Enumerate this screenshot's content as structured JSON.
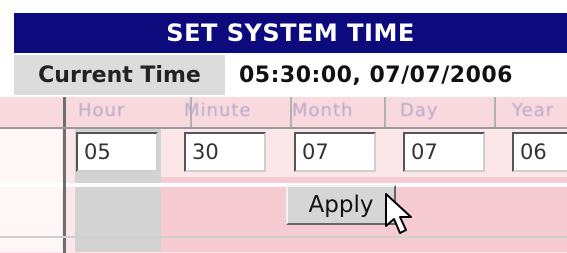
{
  "title": "SET SYSTEM TIME",
  "current_time": {
    "label": "Current Time",
    "value": "05:30:00, 07/07/2006"
  },
  "columns": [
    {
      "name": "hour",
      "header": "Hour",
      "value": "05"
    },
    {
      "name": "minute",
      "header": "Minute",
      "value": "30"
    },
    {
      "name": "month",
      "header": "Month",
      "value": "07"
    },
    {
      "name": "day",
      "header": "Day",
      "value": "07"
    },
    {
      "name": "year",
      "header": "Year",
      "value": "06"
    }
  ],
  "apply_label": "Apply",
  "colors": {
    "title_bg": "#0c0a7c",
    "label_bg": "#dcdcdc",
    "pink_bg": "#fbe7ea"
  }
}
